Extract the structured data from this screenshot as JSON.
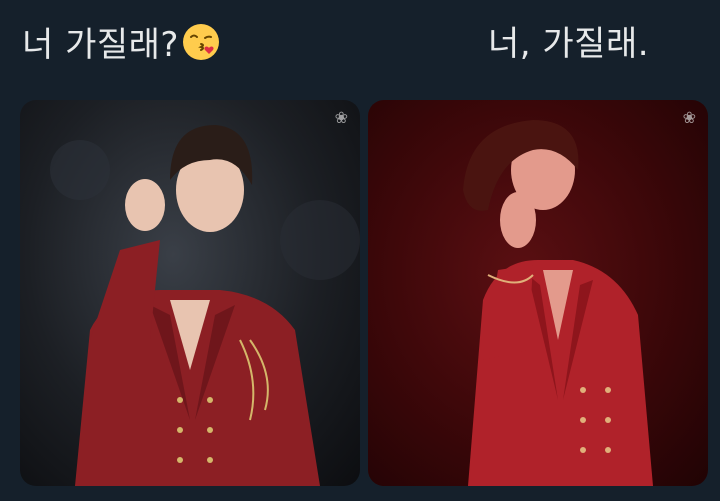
{
  "captions": {
    "left": "너 가질래?",
    "left_emoji": "face-throwing-kiss-emoji",
    "right": "너, 가질래."
  },
  "photos": {
    "left": {
      "subject": "performer-finger-heart-stage-photo",
      "tone": "#8c1f24"
    },
    "right": {
      "subject": "performer-finger-heart-red-light-photo",
      "tone": "#b0222a"
    }
  },
  "watermark_icon": "flower-icon",
  "colors": {
    "background": "#15202b",
    "text": "#e7e9ea"
  }
}
